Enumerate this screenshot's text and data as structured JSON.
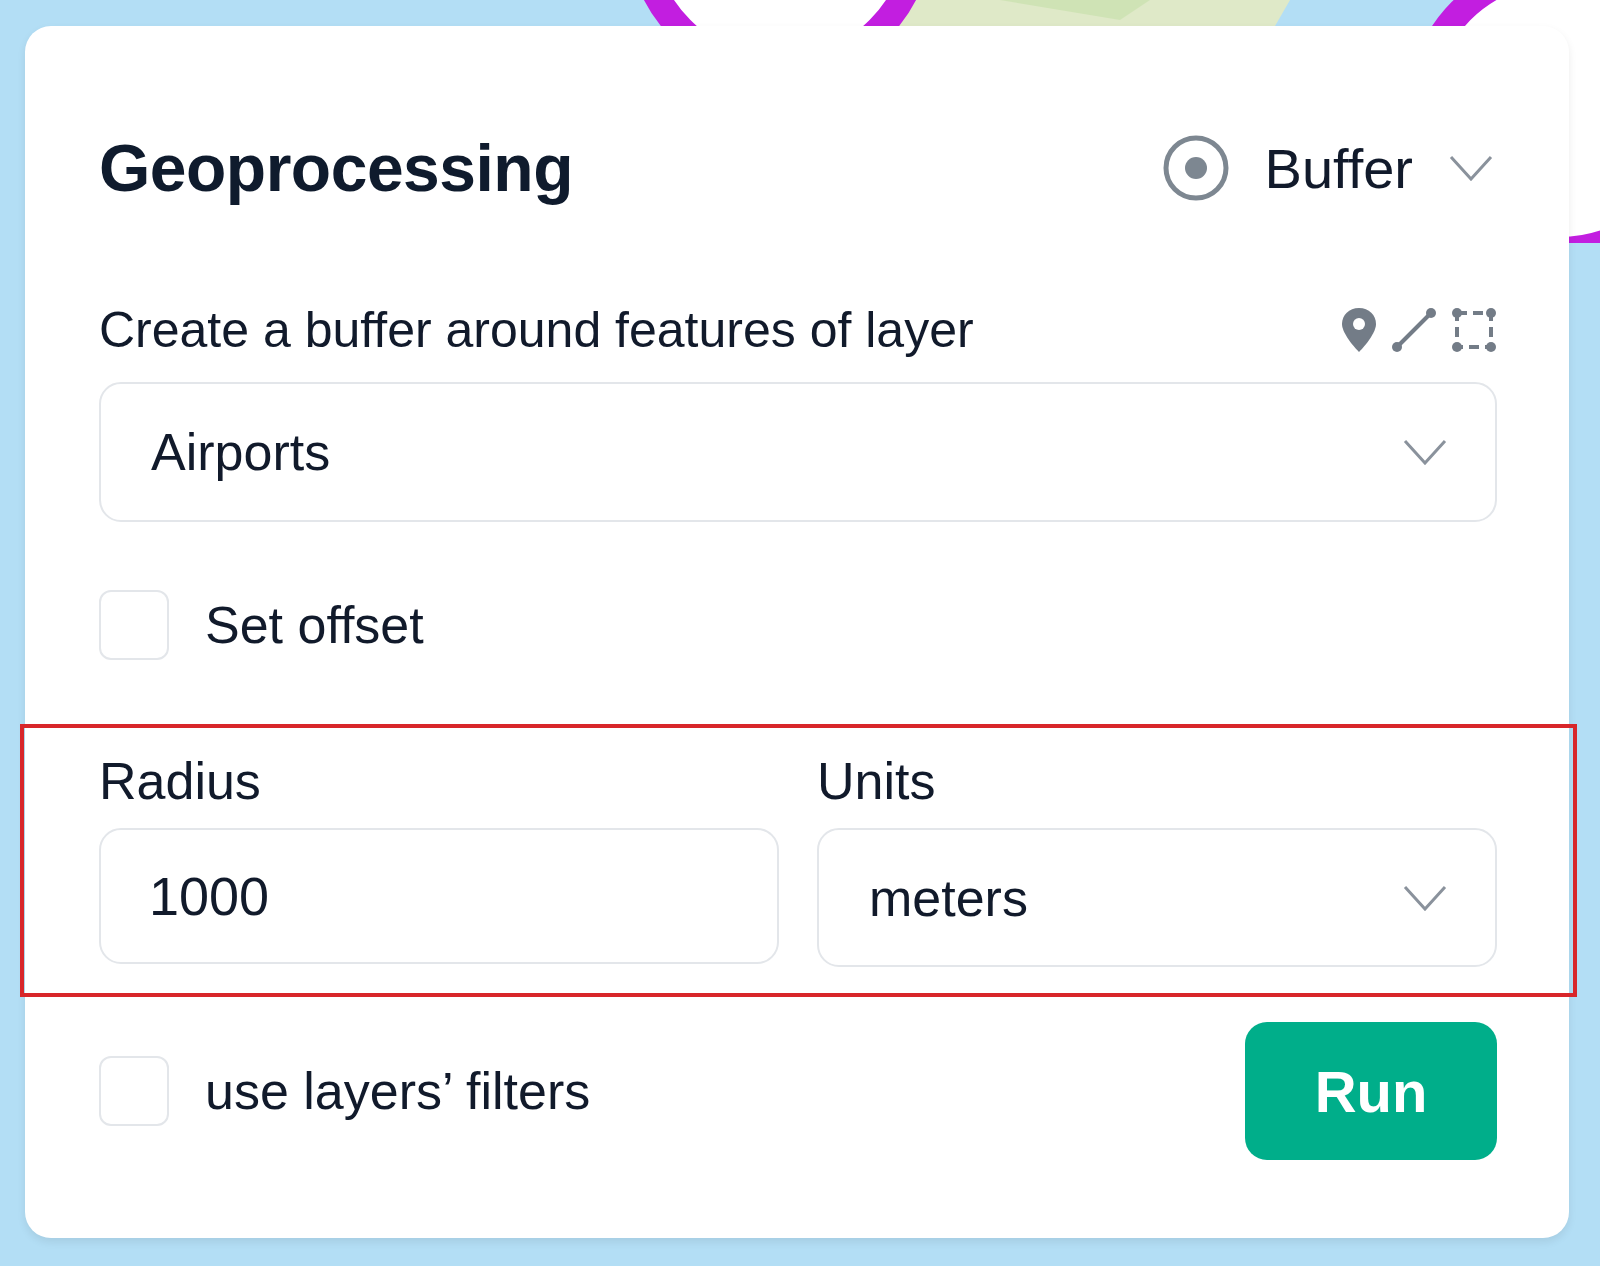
{
  "title": "Geoprocessing",
  "tool_select": {
    "value": "Buffer"
  },
  "layer_prompt": "Create a buffer around features of layer",
  "layer_select": {
    "value": "Airports"
  },
  "set_offset": {
    "label": "Set offset",
    "checked": false
  },
  "radius_units": {
    "highlighted": true,
    "radius": {
      "label": "Radius",
      "value": "1000"
    },
    "units": {
      "label": "Units",
      "value": "meters"
    }
  },
  "use_filters": {
    "label": "use layers’ filters",
    "checked": false
  },
  "run_button": {
    "label": "Run"
  }
}
